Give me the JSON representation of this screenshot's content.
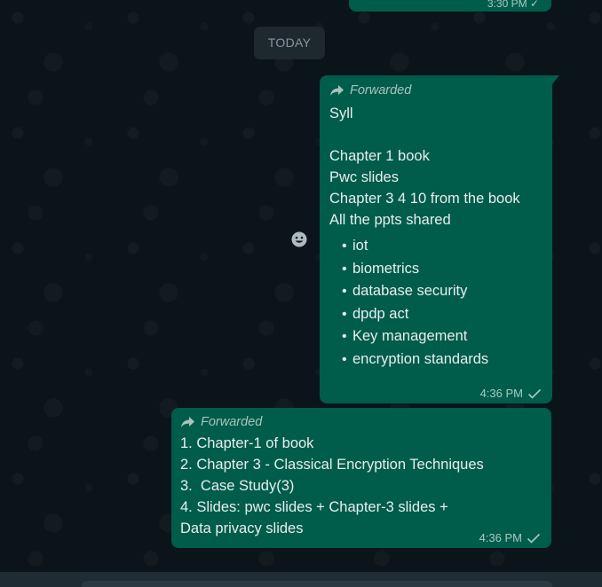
{
  "previous_message": {
    "time": "3:30 PM"
  },
  "date_divider": "TODAY",
  "messages": [
    {
      "forwarded_label": "Forwarded",
      "lines": [
        "Syll",
        "",
        "Chapter 1 book",
        "Pwc slides",
        "Chapter 3 4 10 from the book",
        "All the ppts shared"
      ],
      "bullets": [
        "iot",
        "biometrics",
        "database security",
        "dpdp act",
        "Key management",
        "encryption standards"
      ],
      "time": "4:36 PM"
    },
    {
      "forwarded_label": "Forwarded",
      "lines": [
        "1. Chapter-1 of book",
        "2. Chapter 3 - Classical Encryption Techniques",
        "3.  Case Study(3)",
        "4. Slides: pwc slides + Chapter-3 slides +",
        "Data privacy slides"
      ],
      "time": "4:36 PM"
    }
  ],
  "icons": {
    "forward": "forward-arrow-icon",
    "tick": "single-check-icon",
    "emoji": "emoji-smiley-icon"
  },
  "colors": {
    "background": "#0b141a",
    "outgoing_bubble": "#005c4b",
    "date_chip": "#1d282f",
    "text": "#e9edef",
    "meta": "#a9c9c1"
  }
}
